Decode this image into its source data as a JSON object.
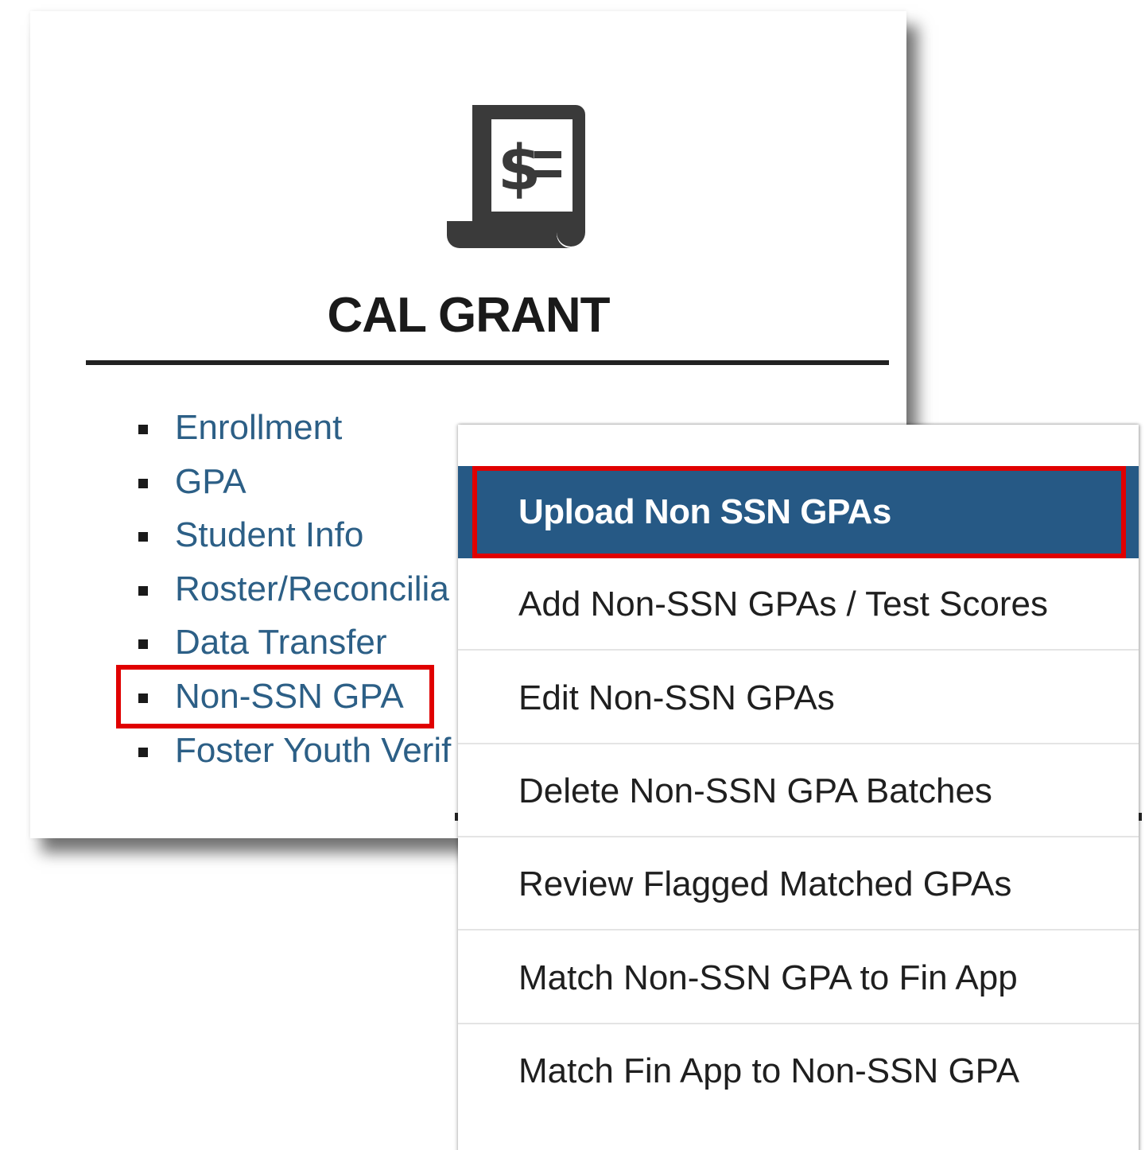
{
  "card": {
    "title": "CAL GRANT",
    "icon": "receipt-dollar-icon",
    "menu": [
      {
        "label": "Enrollment",
        "highlighted": false
      },
      {
        "label": "GPA",
        "highlighted": false
      },
      {
        "label": "Student Info",
        "highlighted": false
      },
      {
        "label": "Roster/Reconcilia",
        "highlighted": false
      },
      {
        "label": "Data Transfer",
        "highlighted": false
      },
      {
        "label": "Non-SSN GPA",
        "highlighted": true
      },
      {
        "label": "Foster Youth Verif",
        "highlighted": false
      }
    ]
  },
  "dropdown": {
    "items": [
      {
        "label": "Upload Non SSN GPAs",
        "active": true
      },
      {
        "label": "Add Non-SSN GPAs / Test Scores",
        "active": false
      },
      {
        "label": "Edit Non-SSN GPAs",
        "active": false
      },
      {
        "label": "Delete Non-SSN GPA Batches",
        "active": false
      },
      {
        "label": "Review Flagged Matched GPAs",
        "active": false
      },
      {
        "label": "Match Non-SSN GPA to Fin App",
        "active": false
      },
      {
        "label": "Match Fin App to Non-SSN GPA",
        "active": false
      }
    ]
  },
  "colors": {
    "link": "#2c5f86",
    "active_bg": "#265985",
    "highlight_border": "#e00000"
  }
}
